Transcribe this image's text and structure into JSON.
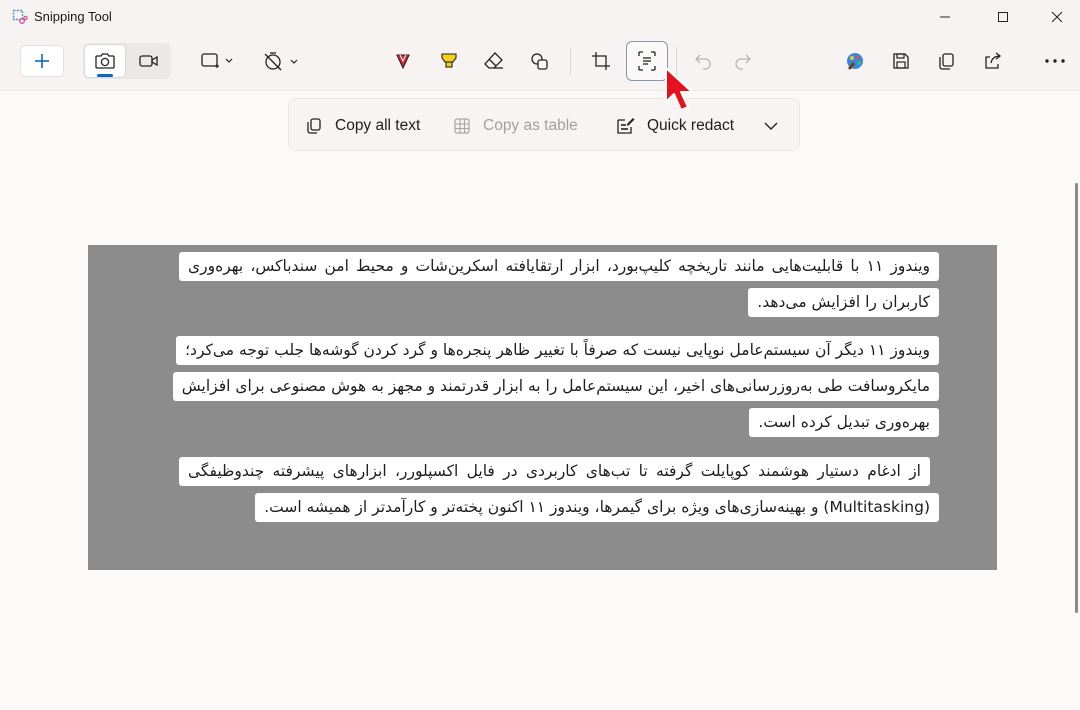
{
  "window": {
    "title": "Snipping Tool"
  },
  "toolbar": {
    "new_icon": "plus-icon",
    "snip_modes": [
      "camera-icon",
      "video-icon"
    ],
    "snip_shape_icon": "rectangle-snip-icon",
    "delay_icon": "timer-off-icon",
    "tools": [
      "red-pen-icon",
      "highlighter-icon",
      "eraser-icon",
      "shapes-icon",
      "crop-icon",
      "text-actions-icon",
      "undo-icon",
      "redo-icon"
    ],
    "right_tools": [
      "paint-icon",
      "save-icon",
      "copy-icon",
      "share-icon",
      "more-icon"
    ]
  },
  "text_actions": {
    "copy_all_text": "Copy all text",
    "copy_as_table": "Copy as table",
    "quick_redact": "Quick redact"
  },
  "content": {
    "paragraphs": [
      "ویندوز ۱۱ با قابلیت‌هایی مانند تاریخچه کلیپ‌بورد، ابزار ارتقایافته اسکرین‌شات و محیط امن سندباکس، بهره‌وری کاربران را افزایش می‌دهد.",
      "ویندوز ۱۱ دیگر آن سیستم‌عامل نوپایی نیست که صرفاً با تغییر ظاهر پنجره‌ها و گرد کردن گوشه‌ها جلب توجه می‌کرد؛ مایکروسافت طی به‌روزرسانی‌های اخیر، این سیستم‌عامل را به ابزار قدرتمند و مجهز به هوش مصنوعی برای افزایش بهره‌وری تبدیل کرده است.",
      "از ادغام دستیار هوشمند کوپایلت گرفته تا تب‌های کاربردی در فایل اکسپلورر، ابزارهای پیشرفته چندوظیفگی (Multitasking) و بهینه‌سازی‌های ویژه برای گیمرها، ویندوز ۱۱ اکنون پخته‌تر و کارآمدتر از همیشه است."
    ]
  },
  "colors": {
    "accent": "#0e67c6",
    "pen": "#e0222d",
    "highlighter": "#f5d21a",
    "canvas_bg": "#8c8c8c",
    "cursor": "#e8101c"
  }
}
